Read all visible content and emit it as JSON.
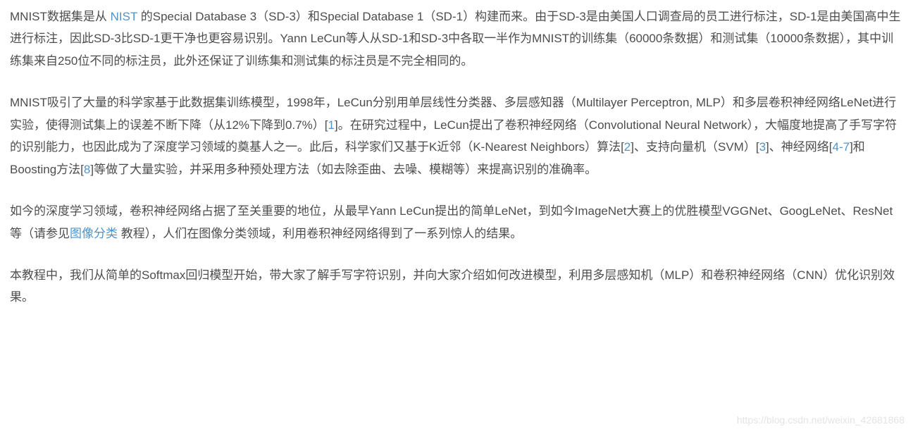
{
  "para1": {
    "t1": "MNIST数据集是从 ",
    "link_nist": "NIST",
    "t2": " 的Special Database 3（SD-3）和Special Database 1（SD-1）构建而来。由于SD-3是由美国人口调查局的员工进行标注，SD-1是由美国高中生进行标注，因此SD-3比SD-1更干净也更容易识别。Yann LeCun等人从SD-1和SD-3中各取一半作为MNIST的训练集（60000条数据）和测试集（10000条数据），其中训练集来自250位不同的标注员，此外还保证了训练集和测试集的标注员是不完全相同的。"
  },
  "para2": {
    "t1": "MNIST吸引了大量的科学家基于此数据集训练模型，1998年，LeCun分别用单层线性分类器、多层感知器（Multilayer Perceptron, MLP）和多层卷积神经网络LeNet进行实验，使得测试集上的误差不断下降（从12%下降到0.7%）[",
    "ref1": "1",
    "t2": "]。在研究过程中，LeCun提出了卷积神经网络（Convolutional Neural Network），大幅度地提高了手写字符的识别能力，也因此成为了深度学习领域的奠基人之一。此后，科学家们又基于K近邻（K-Nearest Neighbors）算法[",
    "ref2": "2",
    "t3": "]、支持向量机（SVM）[",
    "ref3": "3",
    "t4": "]、神经网络[",
    "ref47": "4-7",
    "t5": "]和Boosting方法[",
    "ref8": "8",
    "t6": "]等做了大量实验，并采用多种预处理方法（如去除歪曲、去噪、模糊等）来提高识别的准确率。"
  },
  "para3": {
    "t1": "如今的深度学习领域，卷积神经网络占据了至关重要的地位，从最早Yann LeCun提出的简单LeNet，到如今ImageNet大赛上的优胜模型VGGNet、GoogLeNet、ResNet等（请参见",
    "link_imgcls": "图像分类",
    "t2": " 教程），人们在图像分类领域，利用卷积神经网络得到了一系列惊人的结果。"
  },
  "para4": {
    "t1": "本教程中，我们从简单的Softmax回归模型开始，带大家了解手写字符识别，并向大家介绍如何改进模型，利用多层感知机（MLP）和卷积神经网络（CNN）优化识别效果。"
  },
  "watermark": "https://blog.csdn.net/weixin_42681868"
}
